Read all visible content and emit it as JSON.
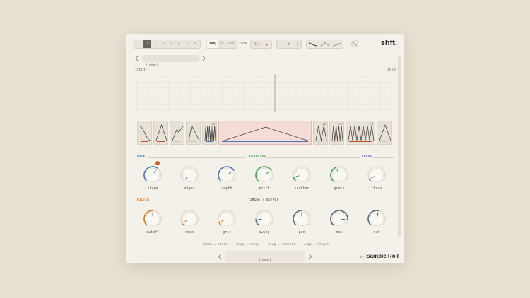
{
  "toolbar": {
    "steps": [
      "1",
      "2",
      "3",
      "4",
      "5",
      "6",
      "7",
      "8"
    ],
    "active_step_index": 1,
    "mode_tabs": [
      "seq",
      "fx",
      "lfo"
    ],
    "active_mode": "seq",
    "rate_label": "rate",
    "rate_value": "2/1",
    "stepper_minus": "—",
    "stepper_value": "t",
    "stepper_plus": "+",
    "curve_icons": [
      "curve-fall-icon",
      "curve-peak-icon",
      "curve-rise-icon"
    ],
    "random_icon": "dice-icon",
    "brand": "shft."
  },
  "preset_top": {
    "value": "(none)"
  },
  "display": {
    "input_label": "input",
    "status": "idle"
  },
  "sequencer": {
    "cells": [
      {
        "shape": "fall-curve",
        "bar_color": "#c0532c",
        "multiplier": ""
      },
      {
        "shape": "triangle",
        "bar_color": "#c0532c",
        "multiplier": ""
      },
      {
        "shape": "ramp-jag",
        "bar_color": "#cfc8ba",
        "multiplier": ""
      },
      {
        "shape": "rise-fall",
        "bar_color": "#cfc8ba",
        "multiplier": ""
      },
      {
        "shape": "comb",
        "bar_color": "#4b76b8",
        "multiplier": "x4"
      },
      {
        "shape": "triangle-wide",
        "bar_color": "#4b76b8",
        "multiplier": ""
      },
      {
        "shape": "double-peak",
        "bar_color": "#cfc8ba",
        "multiplier": "x2"
      },
      {
        "shape": "squiggle",
        "bar_color": "#cfc8ba",
        "multiplier": "x3"
      },
      {
        "shape": "comb-wide",
        "bar_color": "#c0532c",
        "multiplier": "x4"
      },
      {
        "shape": "triangle",
        "bar_color": "#cfc8ba",
        "multiplier": ""
      }
    ]
  },
  "sections": {
    "gate": {
      "label": "GATE",
      "color": "#4b76b8"
    },
    "granular": {
      "label": "GRANULAR",
      "color": "#47a35a"
    },
    "chaos": {
      "label": "CHAOS",
      "color": "#8a5ec4"
    },
    "filter": {
      "label": "FILTER",
      "color": "#d17b2e"
    },
    "timing": {
      "label": "TIMING / OUTPUT",
      "color": "#6d6a63"
    }
  },
  "knobs_row1": [
    {
      "label": "shape",
      "color": "#4b76b8",
      "value": 0.62
    },
    {
      "label": "edges",
      "color": "#4b76b8",
      "value": 0.0
    },
    {
      "label": "depth",
      "color": "#4b76b8",
      "value": 0.7
    },
    {
      "label": "pitch",
      "color": "#47a35a",
      "value": 0.7
    },
    {
      "label": "scatter",
      "color": "#47a35a",
      "value": 0.12
    },
    {
      "label": "grain",
      "color": "#47a35a",
      "value": 0.42
    },
    {
      "label": "chaos",
      "color": "#8a5ec4",
      "value": 0.06
    }
  ],
  "knobs_row2": [
    {
      "label": "cutoff",
      "color": "#d17b2e",
      "value": 0.5
    },
    {
      "label": "reso",
      "color": "#d17b2e",
      "value": 0.05
    },
    {
      "label": "grit",
      "color": "#d17b2e",
      "value": 0.08
    },
    {
      "label": "swing",
      "color": "#5a6b7e",
      "value": 0.15
    },
    {
      "label": "pan",
      "color": "#5a6b7e",
      "value": 0.5
    },
    {
      "label": "mix",
      "color": "#5a6b7e",
      "value": 0.85
    },
    {
      "label": "out",
      "color": "#5a6b7e",
      "value": 0.55
    }
  ],
  "badge": {
    "icon": "link-icon"
  },
  "hints": [
    "click = state",
    "drag ↕ shape",
    "drag ↔ ratchet",
    "edge = length"
  ],
  "preset_bottom": {
    "value": "(none)"
  },
  "footer": {
    "by": "by",
    "brand": "Sample Roll"
  }
}
